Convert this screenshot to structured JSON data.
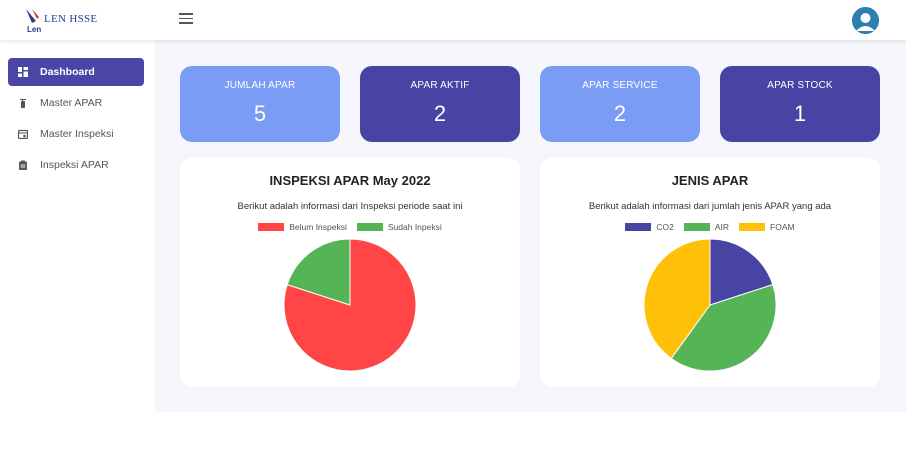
{
  "header": {
    "logo_small": "Len",
    "logo_text": "LEN HSSE"
  },
  "sidebar": {
    "items": [
      {
        "label": "Dashboard",
        "icon": "dashboard-icon"
      },
      {
        "label": "Master APAR",
        "icon": "extinguisher-icon"
      },
      {
        "label": "Master Inspeksi",
        "icon": "calendar-icon"
      },
      {
        "label": "Inspeksi APAR",
        "icon": "clipboard-icon"
      }
    ]
  },
  "stats": [
    {
      "label": "JUMLAH APAR",
      "value": "5",
      "color": "#7b9cf5"
    },
    {
      "label": "APAR AKTIF",
      "value": "2",
      "color": "#4744a3"
    },
    {
      "label": "APAR SERVICE",
      "value": "2",
      "color": "#7b9cf5"
    },
    {
      "label": "APAR STOCK",
      "value": "1",
      "color": "#4744a3"
    }
  ],
  "panels": [
    {
      "title": "INSPEKSI APAR May 2022",
      "subtitle": "Berikut adalah informasi dari Inspeksi periode saat ini",
      "legend": [
        {
          "label": "Belum Inspeksi",
          "color": "#ff4545"
        },
        {
          "label": "Sudah Inpeksi",
          "color": "#55b556"
        }
      ]
    },
    {
      "title": "JENIS APAR",
      "subtitle": "Berikut adalah informasi dari jumlah jenis APAR yang ada",
      "legend": [
        {
          "label": "CO2",
          "color": "#4744a3"
        },
        {
          "label": "AIR",
          "color": "#55b556"
        },
        {
          "label": "FOAM",
          "color": "#ffc107"
        }
      ]
    }
  ],
  "chart_data": [
    {
      "type": "pie",
      "labels": [
        "Belum Inspeksi",
        "Sudah Inpeksi"
      ],
      "values": [
        4,
        1
      ],
      "colors": [
        "#ff4545",
        "#55b556"
      ]
    },
    {
      "type": "pie",
      "labels": [
        "CO2",
        "AIR",
        "FOAM"
      ],
      "values": [
        1,
        2,
        2
      ],
      "colors": [
        "#4744a3",
        "#55b556",
        "#ffc107"
      ]
    }
  ]
}
